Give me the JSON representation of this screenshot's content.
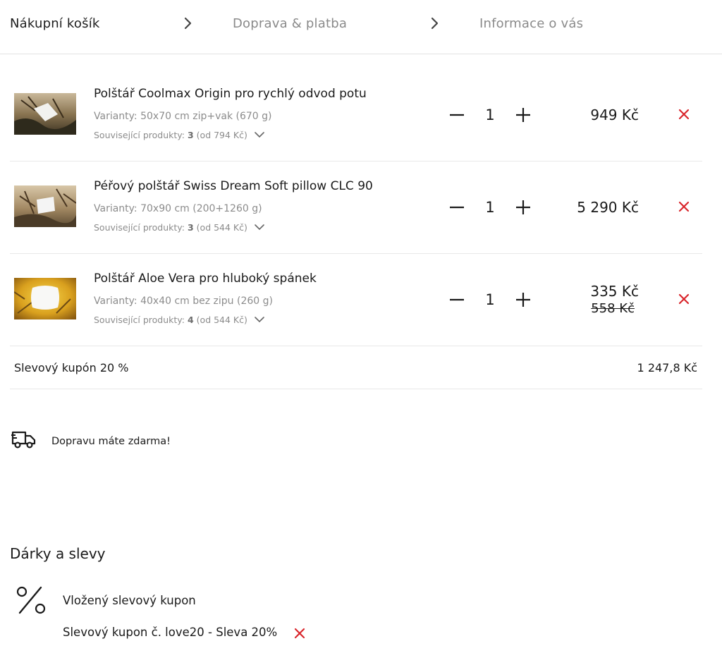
{
  "steps": [
    {
      "label": "Nákupní košík"
    },
    {
      "label": "Doprava & platba"
    },
    {
      "label": "Informace o vás"
    }
  ],
  "items": [
    {
      "name": "Polštář Coolmax Origin pro rychlý odvod potu",
      "variant": "Varianty: 50x70 cm zip+vak (670 g)",
      "related_prefix": "Související produkty:",
      "related_count": "3",
      "related_suffix": "(od 794 Kč)",
      "quantity": "1",
      "price": "949 Kč"
    },
    {
      "name": "Péřový polštář Swiss Dream Soft pillow CLC 90",
      "variant": "Varianty: 70x90 cm (200+1260 g)",
      "related_prefix": "Související produkty:",
      "related_count": "3",
      "related_suffix": "(od 544 Kč)",
      "quantity": "1",
      "price": "5 290 Kč"
    },
    {
      "name": "Polštář Aloe Vera pro hluboký spánek",
      "variant": "Varianty: 40x40 cm bez zipu (260 g)",
      "related_prefix": "Související produkty:",
      "related_count": "4",
      "related_suffix": "(od 544 Kč)",
      "quantity": "1",
      "price": "335 Kč",
      "old_price": "558 Kč"
    }
  ],
  "coupon_row": {
    "label": "Slevový kupón 20 %",
    "amount": "1 247,8 Kč"
  },
  "shipping": {
    "text": "Dopravu máte zdarma!"
  },
  "gifts": {
    "title": "Dárky a slevy",
    "coupon_label": "Vložený slevový kupon",
    "coupon_code": "Slevový kupon č. love20 - Sleva 20%"
  },
  "colors": {
    "remove": "#d9262c",
    "muted": "#8c8c8c",
    "text": "#1a1a1a"
  }
}
